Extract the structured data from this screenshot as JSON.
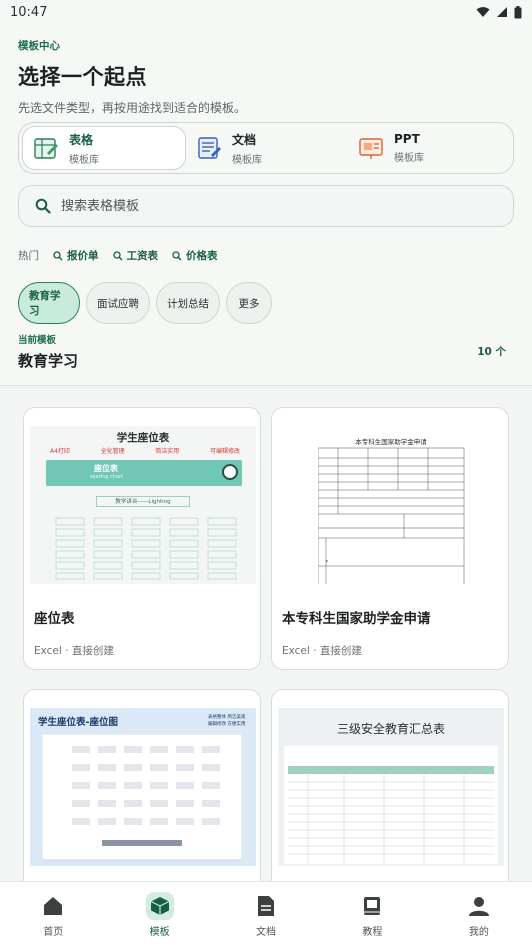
{
  "status": {
    "time": "10:47"
  },
  "header": {
    "overline": "模板中心",
    "title": "选择一个起点",
    "subtitle": "先选文件类型，再按用途找到适合的模板。"
  },
  "types": [
    {
      "name": "表格",
      "sub": "模板库",
      "icon": "spreadsheet-icon",
      "active": true
    },
    {
      "name": "文档",
      "sub": "模板库",
      "icon": "document-icon",
      "active": false
    },
    {
      "name": "PPT",
      "sub": "模板库",
      "icon": "presentation-icon",
      "active": false
    }
  ],
  "search": {
    "placeholder": "搜索表格模板"
  },
  "hot": {
    "label": "热门",
    "tags": [
      "报价单",
      "工资表",
      "价格表"
    ]
  },
  "chips": [
    {
      "label": "教育学习",
      "active": true
    },
    {
      "label": "面试应聘",
      "active": false
    },
    {
      "label": "计划总结",
      "active": false
    },
    {
      "label": "更多",
      "active": false
    }
  ],
  "section": {
    "overline": "当前模板",
    "title": "教育学习",
    "count": "10 个"
  },
  "cards": [
    {
      "title": "座位表",
      "meta": "Excel · 直接创建",
      "thumb": {
        "heading": "学生座位表",
        "checks": [
          "A4打印",
          "全化管理",
          "简洁实用",
          "可编辑修改"
        ],
        "banner": "座位表",
        "banner_sub": "seating chart",
        "podium": "教学讲台——Lighting"
      }
    },
    {
      "title": "本专科生国家助学金申请",
      "meta": "Excel · 直接创建",
      "thumb": {
        "heading": "本专科生国家助学金申请"
      }
    },
    {
      "title": "",
      "meta": "",
      "thumb": {
        "heading": "学生座位表-座位图",
        "note1": "表格整体 简洁美观",
        "note2": "编辑修改 方便实用"
      }
    },
    {
      "title": "",
      "meta": "",
      "thumb": {
        "heading": "三级安全教育汇总表",
        "sub": "三级安全教育汇总表"
      }
    }
  ],
  "nav": [
    {
      "label": "首页",
      "icon": "home-icon",
      "active": false
    },
    {
      "label": "模板",
      "icon": "template-box-icon",
      "active": true
    },
    {
      "label": "文档",
      "icon": "document-icon",
      "active": false
    },
    {
      "label": "教程",
      "icon": "book-icon",
      "active": false
    },
    {
      "label": "我的",
      "icon": "profile-icon",
      "active": false
    }
  ],
  "colors": {
    "accent": "#1a5f44",
    "chip_active": "#c9ebdb",
    "nav_active": "#d2eddf"
  }
}
